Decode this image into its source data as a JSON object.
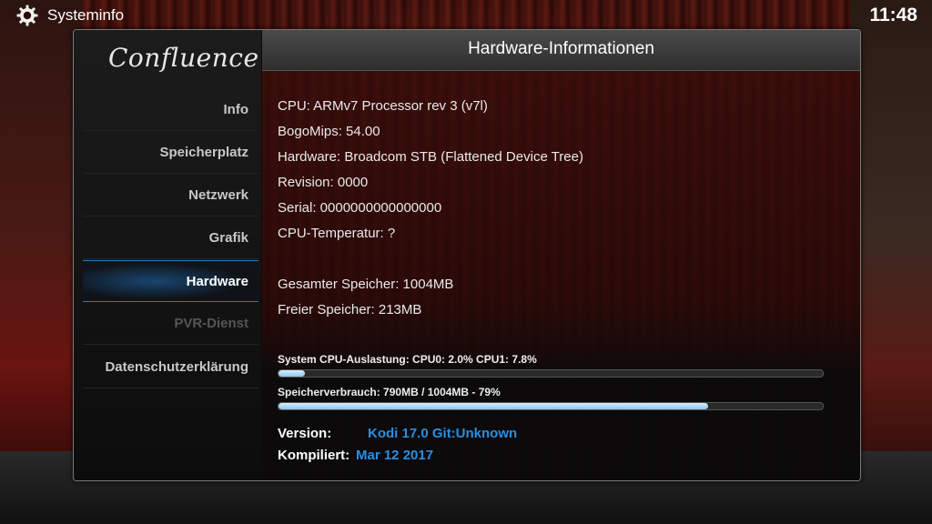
{
  "window": {
    "title": "Systeminfo",
    "clock": "11:48"
  },
  "sidebar": {
    "logo": "Confluence",
    "items": [
      {
        "label": "Info",
        "state": "normal"
      },
      {
        "label": "Speicherplatz",
        "state": "normal"
      },
      {
        "label": "Netzwerk",
        "state": "normal"
      },
      {
        "label": "Grafik",
        "state": "normal"
      },
      {
        "label": "Hardware",
        "state": "active"
      },
      {
        "label": "PVR-Dienst",
        "state": "disabled"
      },
      {
        "label": "Datenschutzerklärung",
        "state": "normal"
      }
    ]
  },
  "main": {
    "title": "Hardware-Informationen",
    "info_lines": [
      "CPU: ARMv7 Processor rev 3 (v7l)",
      "BogoMips: 54.00",
      "Hardware: Broadcom STB (Flattened Device Tree)",
      "Revision: 0000",
      "Serial: 0000000000000000",
      "CPU-Temperatur: ?"
    ],
    "memory_lines": [
      "Gesamter Speicher: 1004MB",
      "Freier Speicher: 213MB"
    ],
    "cpu_bar": {
      "label": "System CPU-Auslastung: CPU0: 2.0% CPU1: 7.8%",
      "percent": 4.9
    },
    "mem_bar": {
      "label": "Speicherverbrauch: 790MB / 1004MB - 79%",
      "percent": 79
    },
    "version": {
      "label": "Version:",
      "value": "Kodi 17.0 Git:Unknown"
    },
    "compiled": {
      "label": "Kompiliert:",
      "value": "Mar 12 2017"
    }
  },
  "colors": {
    "accent": "#2a8fe0",
    "active_glow": "#1e6ebe"
  },
  "icons": {
    "settings": "gear-icon"
  }
}
